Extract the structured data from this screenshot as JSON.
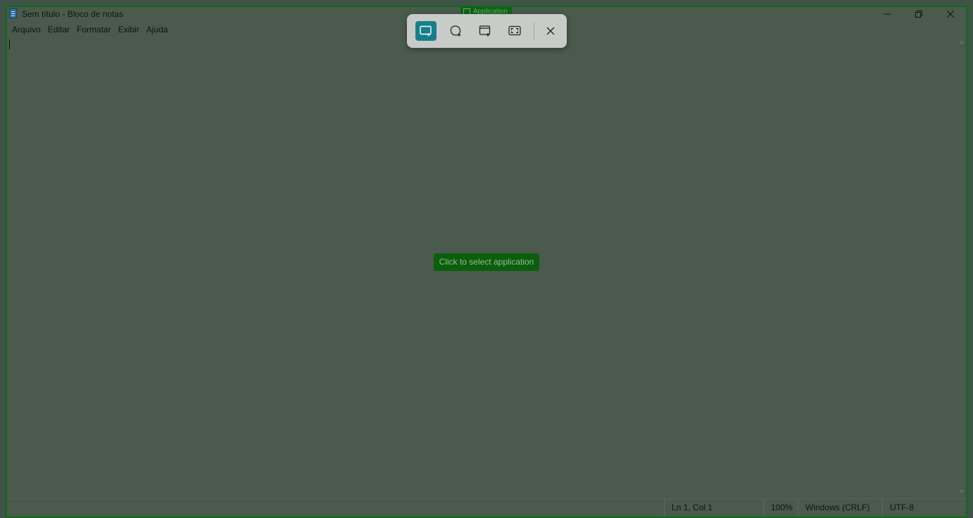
{
  "window": {
    "title": "Sem título - Bloco de notas"
  },
  "menu": {
    "items": [
      "Arquivo",
      "Editar",
      "Formatar",
      "Exibir",
      "Ajuda"
    ]
  },
  "status": {
    "position": "Ln 1, Col 1",
    "zoom": "100%",
    "line_ending": "Windows (CRLF)",
    "encoding": "UTF-8"
  },
  "snip_toolbar": {
    "modes": [
      {
        "icon": "rectangle-snip-icon",
        "active": true
      },
      {
        "icon": "freeform-snip-icon",
        "active": false
      },
      {
        "icon": "window-snip-icon",
        "active": false
      },
      {
        "icon": "fullscreen-snip-icon",
        "active": false
      }
    ],
    "close_icon": "close-icon",
    "accent_color": "#177f8a"
  },
  "overlay": {
    "app_tag": "Application",
    "hint": "Click to select application"
  }
}
